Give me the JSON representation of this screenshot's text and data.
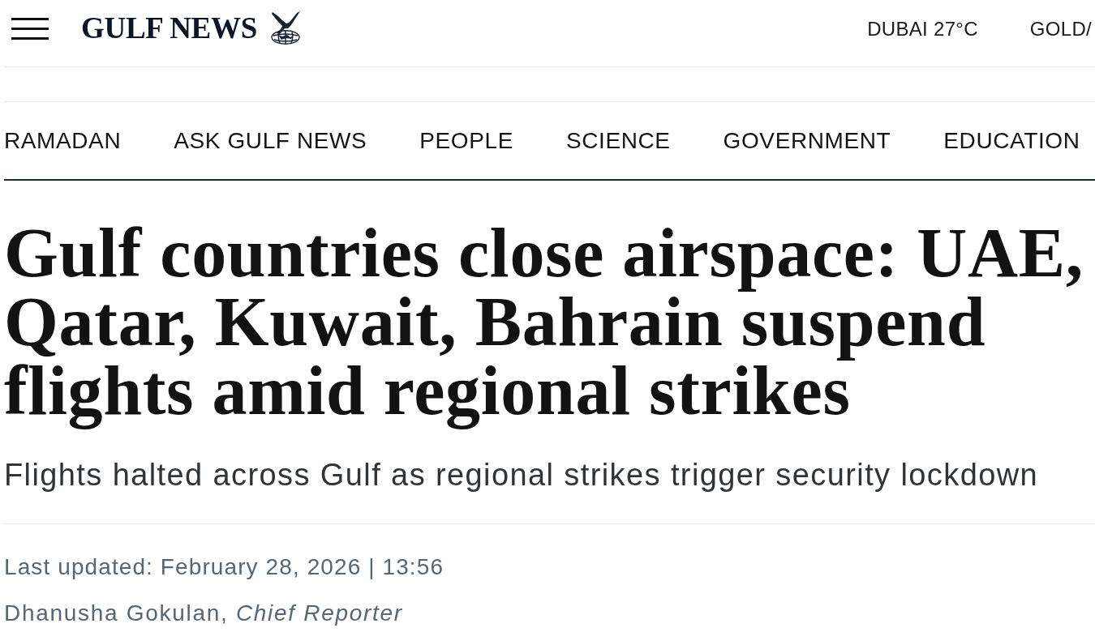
{
  "header": {
    "logo": "GULF NEWS",
    "weather": "DUBAI 27°C",
    "ticker": "GOLD/"
  },
  "nav": {
    "items": [
      "RAMADAN",
      "ASK GULF NEWS",
      "PEOPLE",
      "SCIENCE",
      "GOVERNMENT",
      "EDUCATION"
    ]
  },
  "article": {
    "headline": "Gulf countries close airspace: UAE, Qatar, Kuwait, Bahrain suspend flights amid regional strikes",
    "subheadline": "Flights halted across Gulf as regional strikes trigger security lockdown",
    "updated": "Last updated: February 28, 2026 | 13:56",
    "byline": "Dhanusha Gokulan, *Chief Reporter*"
  }
}
